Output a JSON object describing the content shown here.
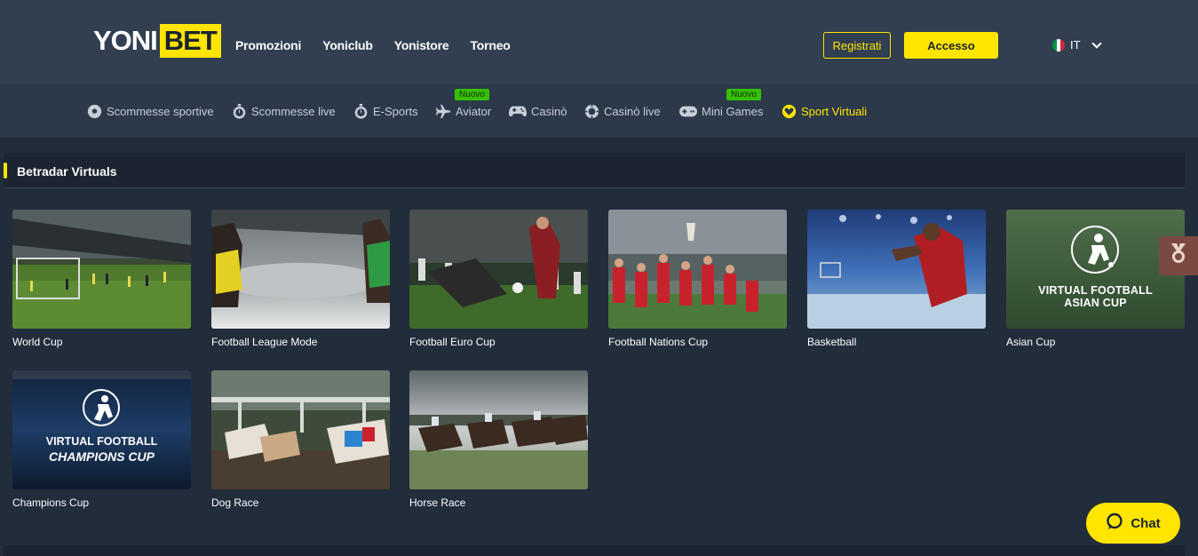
{
  "brand": {
    "logo_part1": "YONI",
    "logo_part2": "BET",
    "accent": "#ffe500"
  },
  "header": {
    "nav": [
      "Promozioni",
      "Yoniclub",
      "Yonistore",
      "Torneo"
    ],
    "register_label": "Registrati",
    "login_label": "Accesso",
    "language": "IT"
  },
  "subnav": {
    "items": [
      {
        "label": "Scommesse sportive",
        "icon": "soccer-ball-icon"
      },
      {
        "label": "Scommesse live",
        "icon": "stopwatch-icon"
      },
      {
        "label": "E-Sports",
        "icon": "stopwatch-icon"
      },
      {
        "label": "Aviator",
        "icon": "plane-icon",
        "badge": "Nuovo"
      },
      {
        "label": "Casinò",
        "icon": "gamepad-icon"
      },
      {
        "label": "Casinò live",
        "icon": "poker-chip-icon"
      },
      {
        "label": "Mini Games",
        "icon": "controller-icon",
        "badge": "Nuovo"
      },
      {
        "label": "Sport Virtuali",
        "icon": "heart-shield-icon",
        "active": true
      }
    ]
  },
  "section": {
    "title": "Betradar Virtuals"
  },
  "games": [
    {
      "name": "World Cup"
    },
    {
      "name": "Football League Mode"
    },
    {
      "name": "Football Euro Cup"
    },
    {
      "name": "Football Nations Cup"
    },
    {
      "name": "Basketball"
    },
    {
      "name": "Asian Cup",
      "overlay_line1": "VIRTUAL FOOTBALL",
      "overlay_line2": "ASIAN CUP"
    },
    {
      "name": "Champions Cup",
      "overlay_line1": "VIRTUAL FOOTBALL",
      "overlay_line2": "CHAMPIONS CUP"
    },
    {
      "name": "Dog Race"
    },
    {
      "name": "Horse Race"
    }
  ],
  "chat": {
    "label": "Chat"
  }
}
